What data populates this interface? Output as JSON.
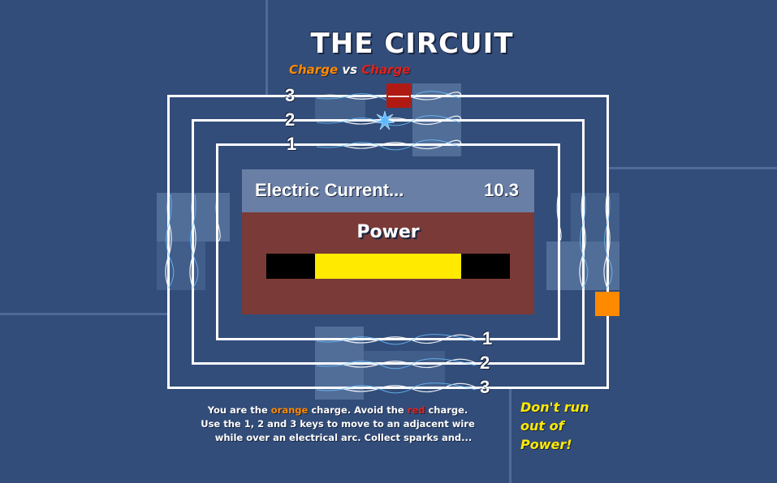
{
  "title": "THE CIRCUIT",
  "subtitle": {
    "part1": "Charge",
    "part2": " vs ",
    "part3": "Charge"
  },
  "colors": {
    "background": "#324d7a",
    "player_charge": "#ff8a00",
    "enemy_charge": "#b11a12",
    "power_bar": "#ffea00",
    "panel_top": "#6a7fa5",
    "panel_bottom": "#7a3a38"
  },
  "wire_labels": {
    "top": [
      "3",
      "2",
      "1"
    ],
    "bottom": [
      "1",
      "2",
      "3"
    ]
  },
  "panel": {
    "current_label": "Electric Current...",
    "current_value": "10.3",
    "power_label": "Power",
    "power_fraction": 0.6
  },
  "instructions": {
    "line1_a": "You are the ",
    "line1_orange": "orange",
    "line1_b": " charge.  Avoid the ",
    "line1_red": "red",
    "line1_c": " charge.",
    "line2": "Use the 1, 2 and 3 keys to move to an adjacent wire",
    "line3": "while over an electrical arc.  Collect sparks and..."
  },
  "warning": "Don't run out of Power!",
  "icons": {
    "spark": "spark-icon"
  }
}
